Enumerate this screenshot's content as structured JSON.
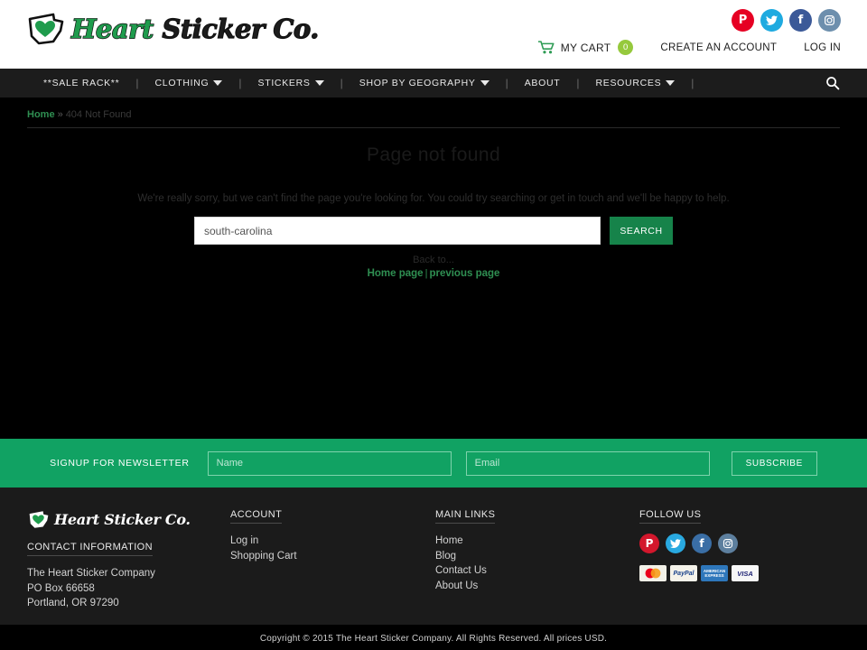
{
  "header": {
    "logo": {
      "icon": "oregon-state-heart-icon",
      "text_part1": "Heart ",
      "text_part2": "Sticker Co."
    },
    "social": [
      {
        "name": "pinterest",
        "glyph": "p"
      },
      {
        "name": "twitter",
        "glyph": "ᵗ"
      },
      {
        "name": "facebook",
        "glyph": "f"
      },
      {
        "name": "instagram",
        "glyph": "□"
      }
    ],
    "cart": {
      "icon": "shopping-cart-icon",
      "label": "MY CART",
      "count": "0"
    },
    "create_account": "CREATE AN ACCOUNT",
    "log_in": "LOG IN"
  },
  "nav": {
    "items": [
      {
        "label": "**SALE RACK**",
        "has_dropdown": false
      },
      {
        "label": "CLOTHING",
        "has_dropdown": true
      },
      {
        "label": "STICKERS",
        "has_dropdown": true
      },
      {
        "label": "SHOP BY GEOGRAPHY",
        "has_dropdown": true
      },
      {
        "label": "ABOUT",
        "has_dropdown": false
      },
      {
        "label": "RESOURCES",
        "has_dropdown": true
      }
    ],
    "search_icon": "search-icon"
  },
  "breadcrumb": {
    "home": "Home",
    "separator": "»",
    "current": "404 Not Found"
  },
  "main": {
    "title": "Page not found",
    "message": "We're really sorry, but we can't find the page you're looking for. You could try searching or get in touch and we'll be happy to help.",
    "search": {
      "value": "south-carolina",
      "placeholder": "",
      "button": "SEARCH"
    },
    "back_to_label": "Back to...",
    "back_home": "Home page",
    "back_pipe": "|",
    "back_previous": "previous page"
  },
  "newsletter": {
    "label": "SIGNUP FOR NEWSLETTER",
    "name_placeholder": "Name",
    "email_placeholder": "Email",
    "subscribe": "SUBSCRIBE"
  },
  "footer": {
    "logo_text": "Heart Sticker Co.",
    "contact_heading": "CONTACT INFORMATION",
    "contact_lines": [
      "The Heart Sticker Company",
      "PO Box 66658",
      "Portland, OR 97290"
    ],
    "account_heading": "ACCOUNT",
    "account_links": [
      "Log in",
      "Shopping Cart"
    ],
    "main_links_heading": "MAIN LINKS",
    "main_links": [
      "Home",
      "Blog",
      "Contact Us",
      "About Us"
    ],
    "follow_heading": "FOLLOW US",
    "social": [
      {
        "name": "pinterest",
        "glyph": "p"
      },
      {
        "name": "twitter",
        "glyph": "ᵗ"
      },
      {
        "name": "facebook",
        "glyph": "f"
      },
      {
        "name": "instagram",
        "glyph": "□"
      }
    ],
    "payments": [
      {
        "name": "mastercard",
        "label": "MasterCard"
      },
      {
        "name": "paypal",
        "label": "PayPal"
      },
      {
        "name": "amex",
        "label": "AMERICAN EXPRESS"
      },
      {
        "name": "visa",
        "label": "VISA"
      }
    ]
  },
  "copyright": "Copyright © 2015 The Heart Sticker Company. All Rights Reserved. All prices USD.",
  "colors": {
    "brand_green": "#1f9c4d",
    "newsletter_green": "#11a263",
    "search_button_green": "#16834a",
    "cart_badge_green": "#96c93d",
    "nav_bg": "#1c1c1c",
    "footer_bg": "#1b1b1b",
    "page_bg": "#000000"
  }
}
